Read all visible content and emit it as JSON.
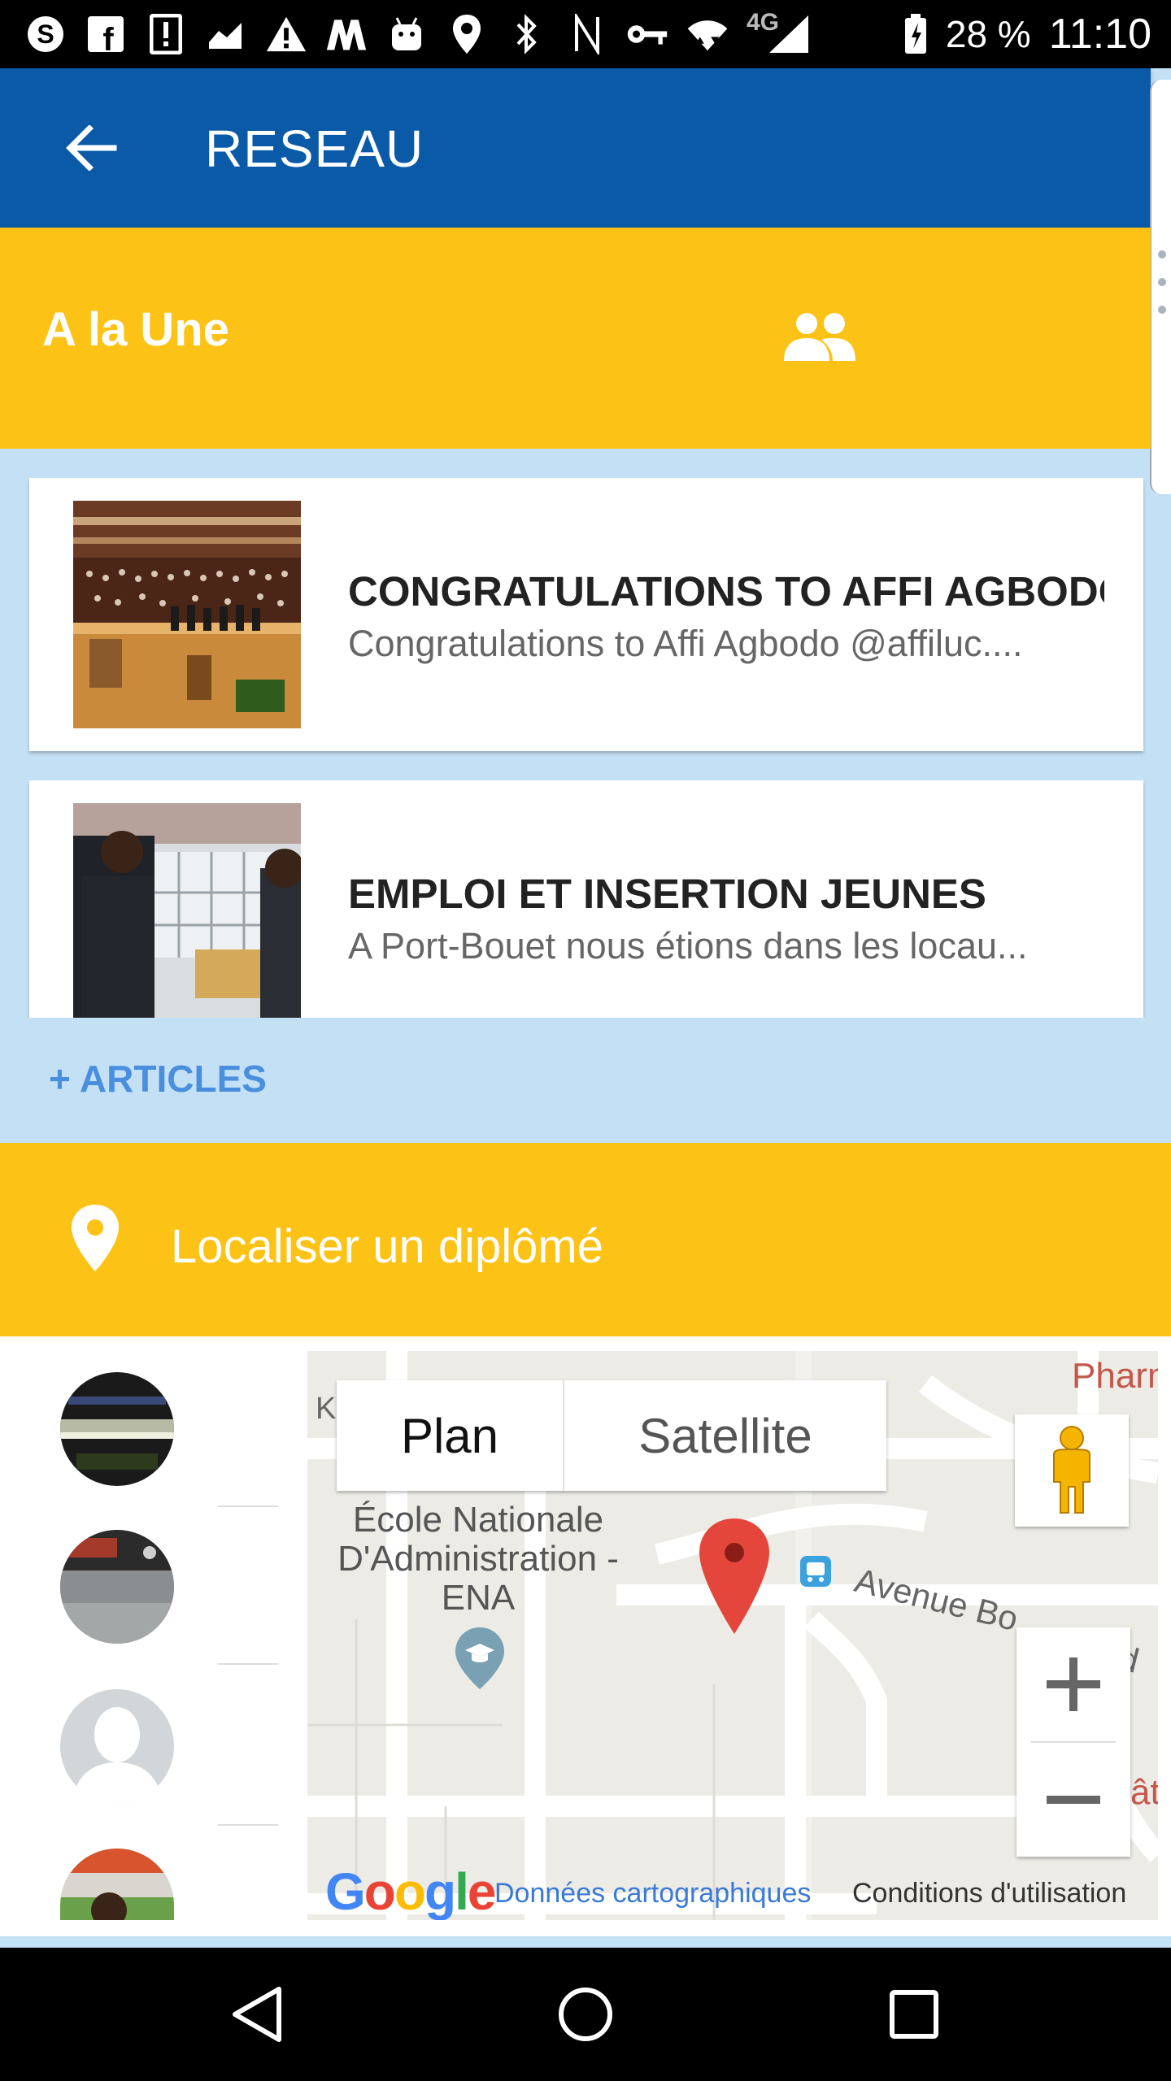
{
  "status_bar": {
    "network": "4G",
    "battery": "28 %",
    "time": "11:10",
    "icons": [
      "skype-icon",
      "facebook-icon",
      "alert-icon",
      "chart-icon",
      "warning-icon",
      "m-app-icon",
      "android-icon",
      "location-icon",
      "bluetooth-icon",
      "nfc-icon",
      "key-icon",
      "wifi-icon",
      "signal-icon",
      "battery-icon"
    ]
  },
  "app_bar": {
    "title": "RESEAU",
    "back_icon": "arrow-back-icon",
    "color": "#0b5aa8"
  },
  "une": {
    "title": "A la Une",
    "icon": "group-icon",
    "color": "#fcc316"
  },
  "articles": [
    {
      "title": "CONGRATULATIONS TO AFFI AGBODO",
      "subtitle": "Congratulations to Affi Agbodo @affiluc...."
    },
    {
      "title": "EMPLOI ET INSERTION JEUNES",
      "subtitle": "A Port-Bouet nous étions dans les locau..."
    }
  ],
  "more_articles": "+ ARTICLES",
  "localiser": {
    "label": "Localiser un diplômé",
    "icon": "location-pin-icon"
  },
  "map": {
    "toggle_plan": "Plan",
    "toggle_satellite": "Satellite",
    "place_name": "École Nationale D'Administration - ENA",
    "street_label": "Avenue Bo",
    "street_label_end": "ud",
    "top_right_label": "Pharm",
    "side_label": "âte",
    "edge_k": "K",
    "google": "Google",
    "map_data_link": "Données cartographiques",
    "terms_link": "Conditions d'utilisation"
  },
  "nav": {
    "back": "nav-back-icon",
    "home": "nav-home-icon",
    "recents": "nav-recents-icon"
  }
}
